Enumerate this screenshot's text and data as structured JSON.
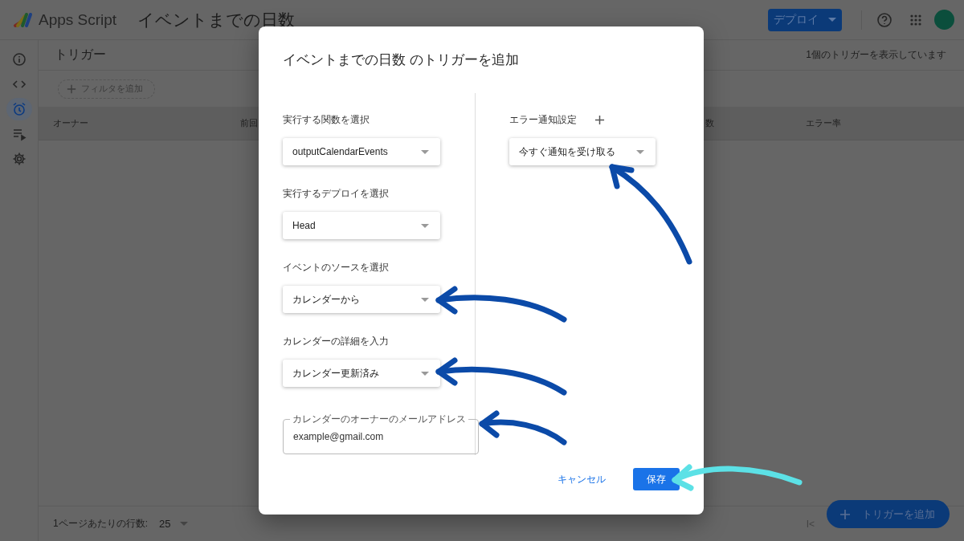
{
  "header": {
    "product": "Apps Script",
    "project": "イベントまでの日数",
    "deploy_button": "デプロイ"
  },
  "sidebar": {
    "items": [
      {
        "kind": "info",
        "selected": false
      },
      {
        "kind": "code",
        "selected": false
      },
      {
        "kind": "triggers",
        "selected": true
      },
      {
        "kind": "executions",
        "selected": false
      },
      {
        "kind": "settings",
        "selected": false
      }
    ]
  },
  "page": {
    "title": "トリガー",
    "count": "1個のトリガーを表示しています",
    "filter_button": "フィルタを追加",
    "columns": [
      "オーナー",
      "前回",
      "数",
      "エラー率"
    ]
  },
  "footer": {
    "rows_per_page_label": "1ページあたりの行数:",
    "rows_per_page": "25",
    "first_page": "I<"
  },
  "add_trigger_button": "トリガーを追加",
  "dialog": {
    "title": "イベントまでの日数 のトリガーを追加",
    "fields": [
      {
        "kind": "select",
        "label": "実行する関数を選択",
        "value": "outputCalendarEvents"
      },
      {
        "kind": "select",
        "label": "実行するデプロイを選択",
        "value": "Head"
      },
      {
        "kind": "select",
        "label": "イベントのソースを選択",
        "value": "カレンダーから"
      },
      {
        "kind": "select",
        "label": "カレンダーの詳細を入力",
        "value": "カレンダー更新済み"
      },
      {
        "kind": "text",
        "label": "カレンダーのオーナーのメールアドレス",
        "value": "example@gmail.com"
      }
    ],
    "error_notification": {
      "label": "エラー通知設定",
      "value": "今すぐ通知を受け取る"
    },
    "cancel_button": "キャンセル",
    "save_button": "保存"
  },
  "annotation_arrows": [
    {
      "color": "#0b4aa8"
    },
    {
      "color": "#0b4aa8"
    },
    {
      "color": "#0b4aa8"
    },
    {
      "color": "#0b4aa8"
    },
    {
      "color": "#5ce1e6"
    }
  ]
}
